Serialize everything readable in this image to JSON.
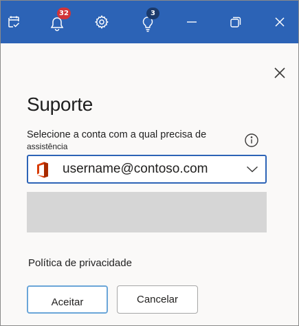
{
  "titlebar": {
    "color": "#2c63b6",
    "buttons": [
      {
        "icon": "calendar-check-icon"
      },
      {
        "icon": "bell-icon",
        "badge": "32",
        "badge_color": "#d13438"
      },
      {
        "icon": "gear-icon"
      },
      {
        "icon": "lightbulb-icon",
        "badge": "3",
        "badge_color": "#1b3a6b"
      },
      {
        "icon": "minimize-icon"
      },
      {
        "icon": "restore-icon"
      },
      {
        "icon": "close-icon"
      }
    ]
  },
  "pane": {
    "title": "Suporte",
    "prompt_line1": "Selecione a conta com a qual precisa de",
    "prompt_line2": "assistência",
    "account": {
      "value": "username@contoso.com",
      "icon": "office-logo-icon"
    },
    "privacy_link": "Política de privacidade",
    "accept_label": "Aceitar",
    "cancel_label": "Cancelar"
  }
}
